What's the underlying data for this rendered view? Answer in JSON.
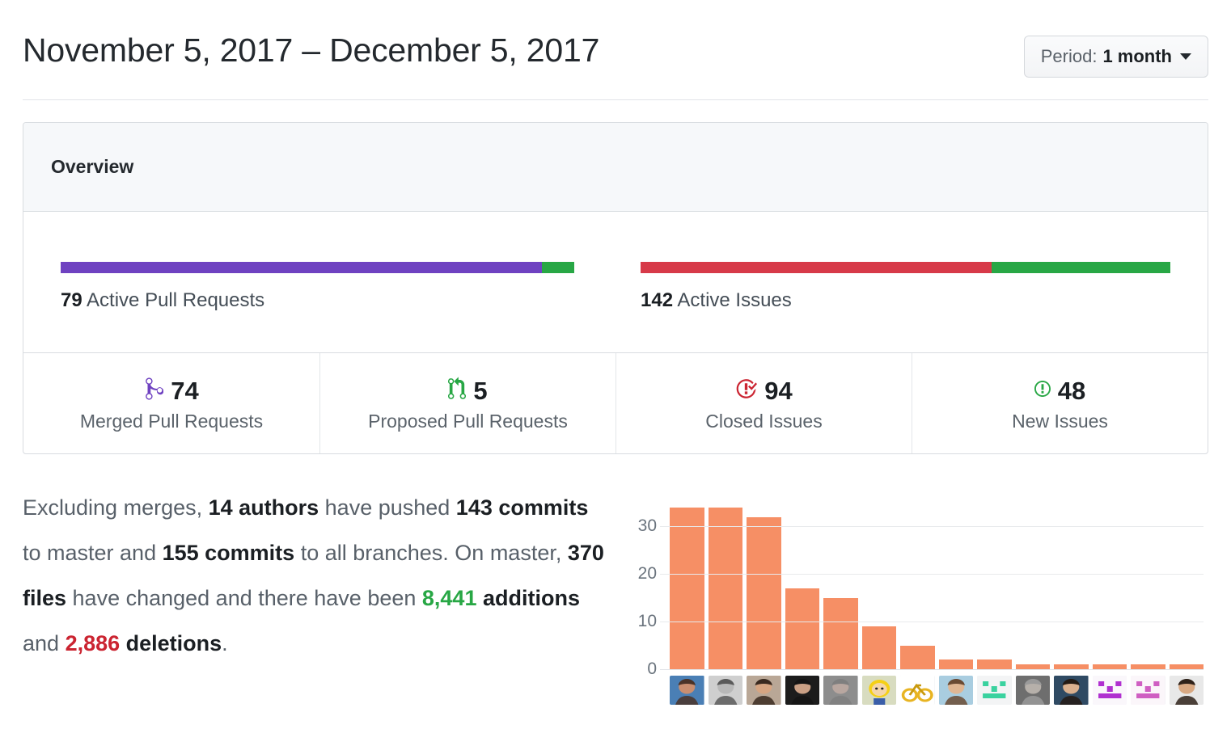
{
  "header": {
    "title": "November 5, 2017 – December 5, 2017",
    "period_label": "Period:",
    "period_value": "1 month"
  },
  "overview": {
    "card_title": "Overview",
    "pull_requests": {
      "count": "79",
      "caption_suffix": " Active Pull Requests",
      "merged_pct": 93.7,
      "proposed_pct": 6.3,
      "merged_color": "#6f42c1",
      "proposed_color": "#28a745"
    },
    "issues": {
      "count": "142",
      "caption_suffix": " Active Issues",
      "closed_pct": 66.2,
      "new_pct": 33.8,
      "closed_color": "#d73a49",
      "new_color": "#28a745"
    },
    "stats": [
      {
        "icon": "git-merge-icon",
        "value": "74",
        "label": "Merged Pull Requests",
        "color": "#6f42c1"
      },
      {
        "icon": "git-pull-request-icon",
        "value": "5",
        "label": "Proposed Pull Requests",
        "color": "#28a745"
      },
      {
        "icon": "issue-closed-icon",
        "value": "94",
        "label": "Closed Issues",
        "color": "#cb2431"
      },
      {
        "icon": "issue-opened-icon",
        "value": "48",
        "label": "New Issues",
        "color": "#28a745"
      }
    ]
  },
  "summary": {
    "t1": "Excluding merges, ",
    "authors": "14 authors",
    "t2": " have pushed ",
    "commits_master": "143 commits",
    "t3": " to master and ",
    "commits_all": "155 commits",
    "t4": " to all branches. On master, ",
    "files": "370 files",
    "t5": " have changed and there have been ",
    "additions_num": "8,441",
    "additions_word": " additions",
    "t6": " and ",
    "deletions_num": "2,886",
    "deletions_word": " deletions",
    "t7": "."
  },
  "chart_data": {
    "type": "bar",
    "title": "",
    "xlabel": "",
    "ylabel": "",
    "ylim": [
      0,
      36
    ],
    "yticks": [
      0,
      10,
      20,
      30
    ],
    "ytick_labels": [
      "0",
      "10",
      "20",
      "30"
    ],
    "grid": true,
    "legend": "none",
    "bar_color": "#f68f65",
    "categories": [
      "author-1",
      "author-2",
      "author-3",
      "author-4",
      "author-5",
      "author-6",
      "author-7",
      "author-8",
      "author-9",
      "author-10",
      "author-11",
      "author-12",
      "author-13",
      "author-14"
    ],
    "values": [
      34,
      34,
      32,
      17,
      15,
      9,
      5,
      2,
      2,
      1,
      1,
      1,
      1,
      1
    ],
    "tick_label_type": "avatar-image",
    "avatars": [
      {
        "name": "avatar-1",
        "kind": "photo-person",
        "bg": "#4a7fb5",
        "skin": "#c98e70",
        "hair": "#4a3328"
      },
      {
        "name": "avatar-2",
        "kind": "photo-person",
        "bg": "#cfcfcf",
        "skin": "#b8b8b8",
        "hair": "#5a5a5a"
      },
      {
        "name": "avatar-3",
        "kind": "photo-person",
        "bg": "#b9a796",
        "skin": "#d6a582",
        "hair": "#3a2a20"
      },
      {
        "name": "avatar-4",
        "kind": "photo-person",
        "bg": "#1c1c1c",
        "skin": "#caa085",
        "hair": "#141414"
      },
      {
        "name": "avatar-5",
        "kind": "photo-person",
        "bg": "#8d8d8d",
        "skin": "#b9a7a0",
        "hair": "#7f7f7f"
      },
      {
        "name": "avatar-6",
        "kind": "cartoon-blond",
        "bg": "#d8dcc0",
        "skin": "#f5d6a8",
        "hair": "#f5d016"
      },
      {
        "name": "avatar-7",
        "kind": "bicycle",
        "bg": "#ffffff",
        "skin": "#e8b422",
        "hair": "#c99a10"
      },
      {
        "name": "avatar-8",
        "kind": "photo-person",
        "bg": "#a9cde0",
        "skin": "#e0b693",
        "hair": "#6a4a33"
      },
      {
        "name": "avatar-9",
        "kind": "identicon-green",
        "bg": "#f3f4f5",
        "skin": "#3ad29f",
        "hair": "#3ad29f"
      },
      {
        "name": "avatar-10",
        "kind": "photo-person",
        "bg": "#6e6e6e",
        "skin": "#b6b0aa",
        "hair": "#9a9a9a"
      },
      {
        "name": "avatar-11",
        "kind": "photo-person",
        "bg": "#2f4a63",
        "skin": "#dbb08e",
        "hair": "#241a14"
      },
      {
        "name": "avatar-12",
        "kind": "identicon-purple",
        "bg": "#faf7fb",
        "skin": "#b030d0",
        "hair": "#b030d0"
      },
      {
        "name": "avatar-13",
        "kind": "identicon-pink",
        "bg": "#fbf6fa",
        "skin": "#cf5fc2",
        "hair": "#cf5fc2"
      },
      {
        "name": "avatar-14",
        "kind": "photo-person",
        "bg": "#e8e8e8",
        "skin": "#d8a882",
        "hair": "#2e2119"
      }
    ]
  }
}
